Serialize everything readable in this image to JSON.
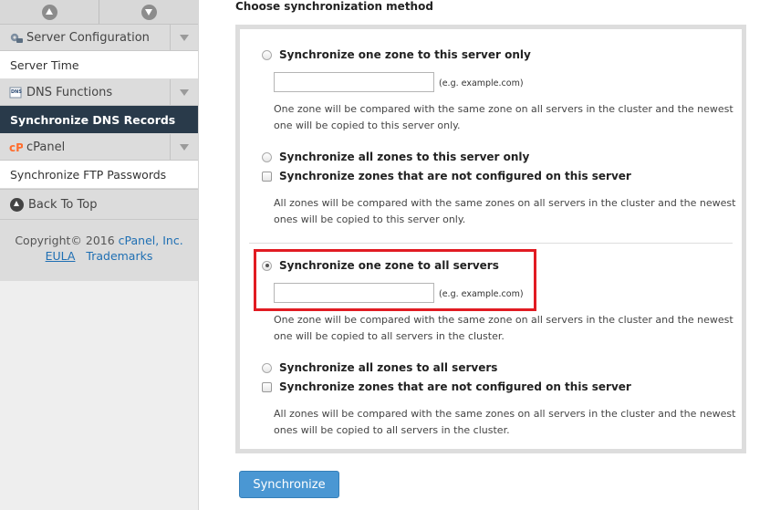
{
  "sidebar": {
    "categories": [
      {
        "label": "Server Configuration",
        "icon": "gear-icon",
        "items": [
          "Server Time"
        ]
      },
      {
        "label": "DNS Functions",
        "icon": "dns-icon",
        "items": [
          "Synchronize DNS Records"
        ]
      },
      {
        "label": "cPanel",
        "icon": "cpanel-logo-icon",
        "items": [
          "Synchronize FTP Passwords"
        ]
      }
    ],
    "active_item": "Synchronize DNS Records",
    "back_to_top": "Back To Top",
    "footer": {
      "copyright": "Copyright© 2016",
      "company": "cPanel, Inc.",
      "eula": "EULA",
      "trademarks": "Trademarks"
    }
  },
  "main": {
    "section_title": "Choose synchronization method",
    "options": [
      {
        "label": "Synchronize one zone to this server only",
        "selected": false,
        "input_placeholder": "",
        "input_hint": "(e.g. example.com)",
        "description": "One zone will be compared with the same zone on all servers in the cluster and the newest one will be copied to this server only."
      },
      {
        "label": "Synchronize all zones to this server only",
        "selected": false,
        "checkbox_label": "Synchronize zones that are not configured on this server",
        "checkbox_checked": false,
        "description": "All zones will be compared with the same zones on all servers in the cluster and the newest ones will be copied to this server only."
      },
      {
        "label": "Synchronize one zone to all servers",
        "selected": true,
        "input_placeholder": "",
        "input_hint": "(e.g. example.com)",
        "description": "One zone will be compared with the same zone on all servers in the cluster and the newest one will be copied to all servers in the cluster."
      },
      {
        "label": "Synchronize all zones to all servers",
        "selected": false,
        "checkbox_label": "Synchronize zones that are not configured on this server",
        "checkbox_checked": false,
        "description": "All zones will be compared with the same zones on all servers in the cluster and the newest ones will be copied to all servers in the cluster."
      }
    ],
    "submit_label": "Synchronize"
  },
  "colors": {
    "active_nav_bg": "#293a4a",
    "button_bg": "#4a97d3",
    "highlight_border": "#e11b22",
    "link": "#1f6fb3"
  }
}
